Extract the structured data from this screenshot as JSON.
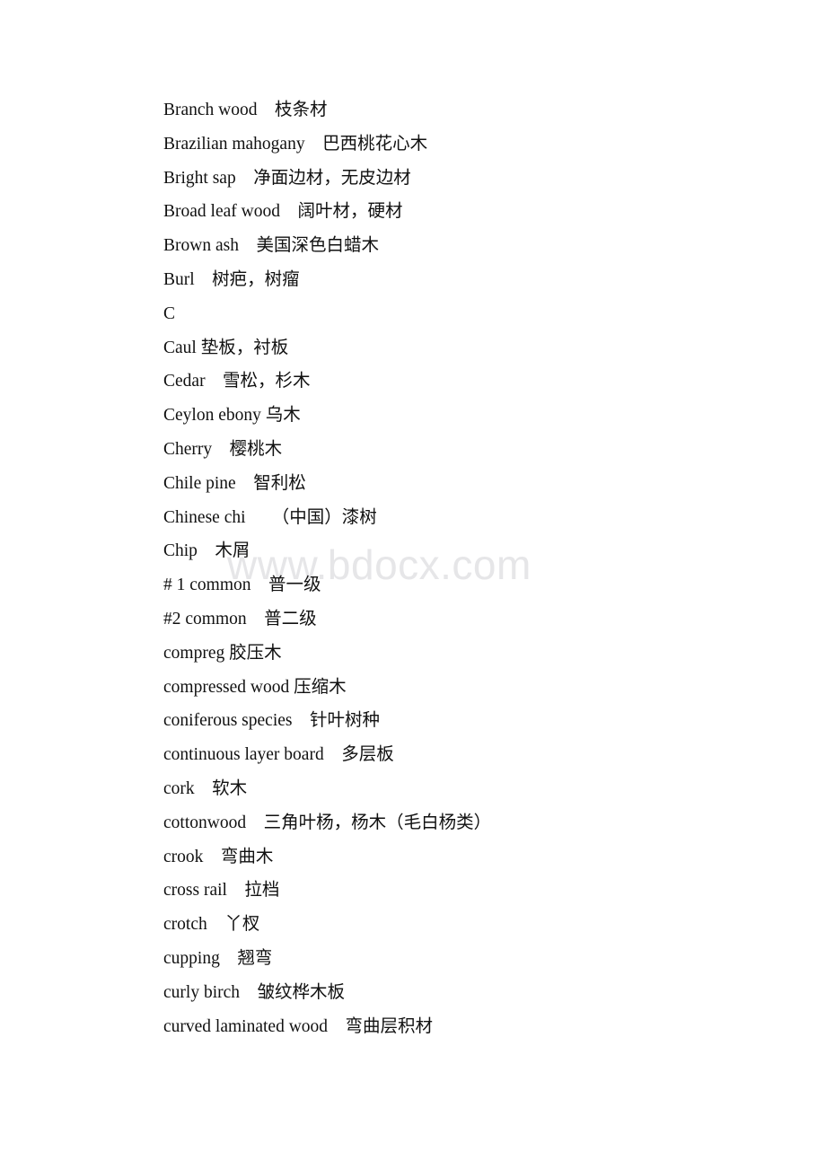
{
  "document": {
    "type": "glossary-page",
    "language_pair": "English-Chinese",
    "background_color": "#ffffff",
    "text_color": "#111111"
  },
  "watermark": {
    "text": "www.bdocx.com",
    "color": "#e6e6e8"
  },
  "glossary": {
    "entries": [
      {
        "id": "branch-wood",
        "text": "Branch wood　枝条材"
      },
      {
        "id": "brazilian-mahogany",
        "text": "Brazilian mahogany　巴西桃花心木"
      },
      {
        "id": "bright-sap",
        "text": "Bright sap　净面边材，无皮边材"
      },
      {
        "id": "broad-leaf-wood",
        "text": "Broad leaf wood　阔叶材，硬材"
      },
      {
        "id": "brown-ash",
        "text": "Brown ash　美国深色白蜡木"
      },
      {
        "id": "burl",
        "text": "Burl　树疤，树瘤"
      },
      {
        "id": "section-c",
        "text": "C",
        "is_section_letter": true
      },
      {
        "id": "caul",
        "text": "Caul 垫板，衬板"
      },
      {
        "id": "cedar",
        "text": "Cedar　雪松，杉木"
      },
      {
        "id": "ceylon-ebony",
        "text": "Ceylon ebony 乌木"
      },
      {
        "id": "cherry",
        "text": "Cherry　樱桃木"
      },
      {
        "id": "chile-pine",
        "text": "Chile pine　智利松"
      },
      {
        "id": "chinese-chi",
        "text": "Chinese chi　　（中国）漆树"
      },
      {
        "id": "chip",
        "text": "Chip　木屑"
      },
      {
        "id": "number-1-common",
        "text": "# 1 common　普一级"
      },
      {
        "id": "number-2-common",
        "text": "#2 common　普二级"
      },
      {
        "id": "compreg",
        "text": "compreg 胶压木"
      },
      {
        "id": "compressed-wood",
        "text": "compressed wood 压缩木"
      },
      {
        "id": "coniferous-species",
        "text": "coniferous species　针叶树种"
      },
      {
        "id": "continuous-layer-board",
        "text": "continuous layer board　多层板"
      },
      {
        "id": "cork",
        "text": "cork　软木"
      },
      {
        "id": "cottonwood",
        "text": "cottonwood　三角叶杨，杨木（毛白杨类）"
      },
      {
        "id": "crook",
        "text": "crook　弯曲木"
      },
      {
        "id": "cross-rail",
        "text": "cross rail　拉档"
      },
      {
        "id": "crotch",
        "text": "crotch　丫杈"
      },
      {
        "id": "cupping",
        "text": "cupping　翘弯"
      },
      {
        "id": "curly-birch",
        "text": "curly birch　皱纹桦木板"
      },
      {
        "id": "curved-laminated-wood",
        "text": "curved laminated wood　弯曲层积材"
      }
    ]
  }
}
